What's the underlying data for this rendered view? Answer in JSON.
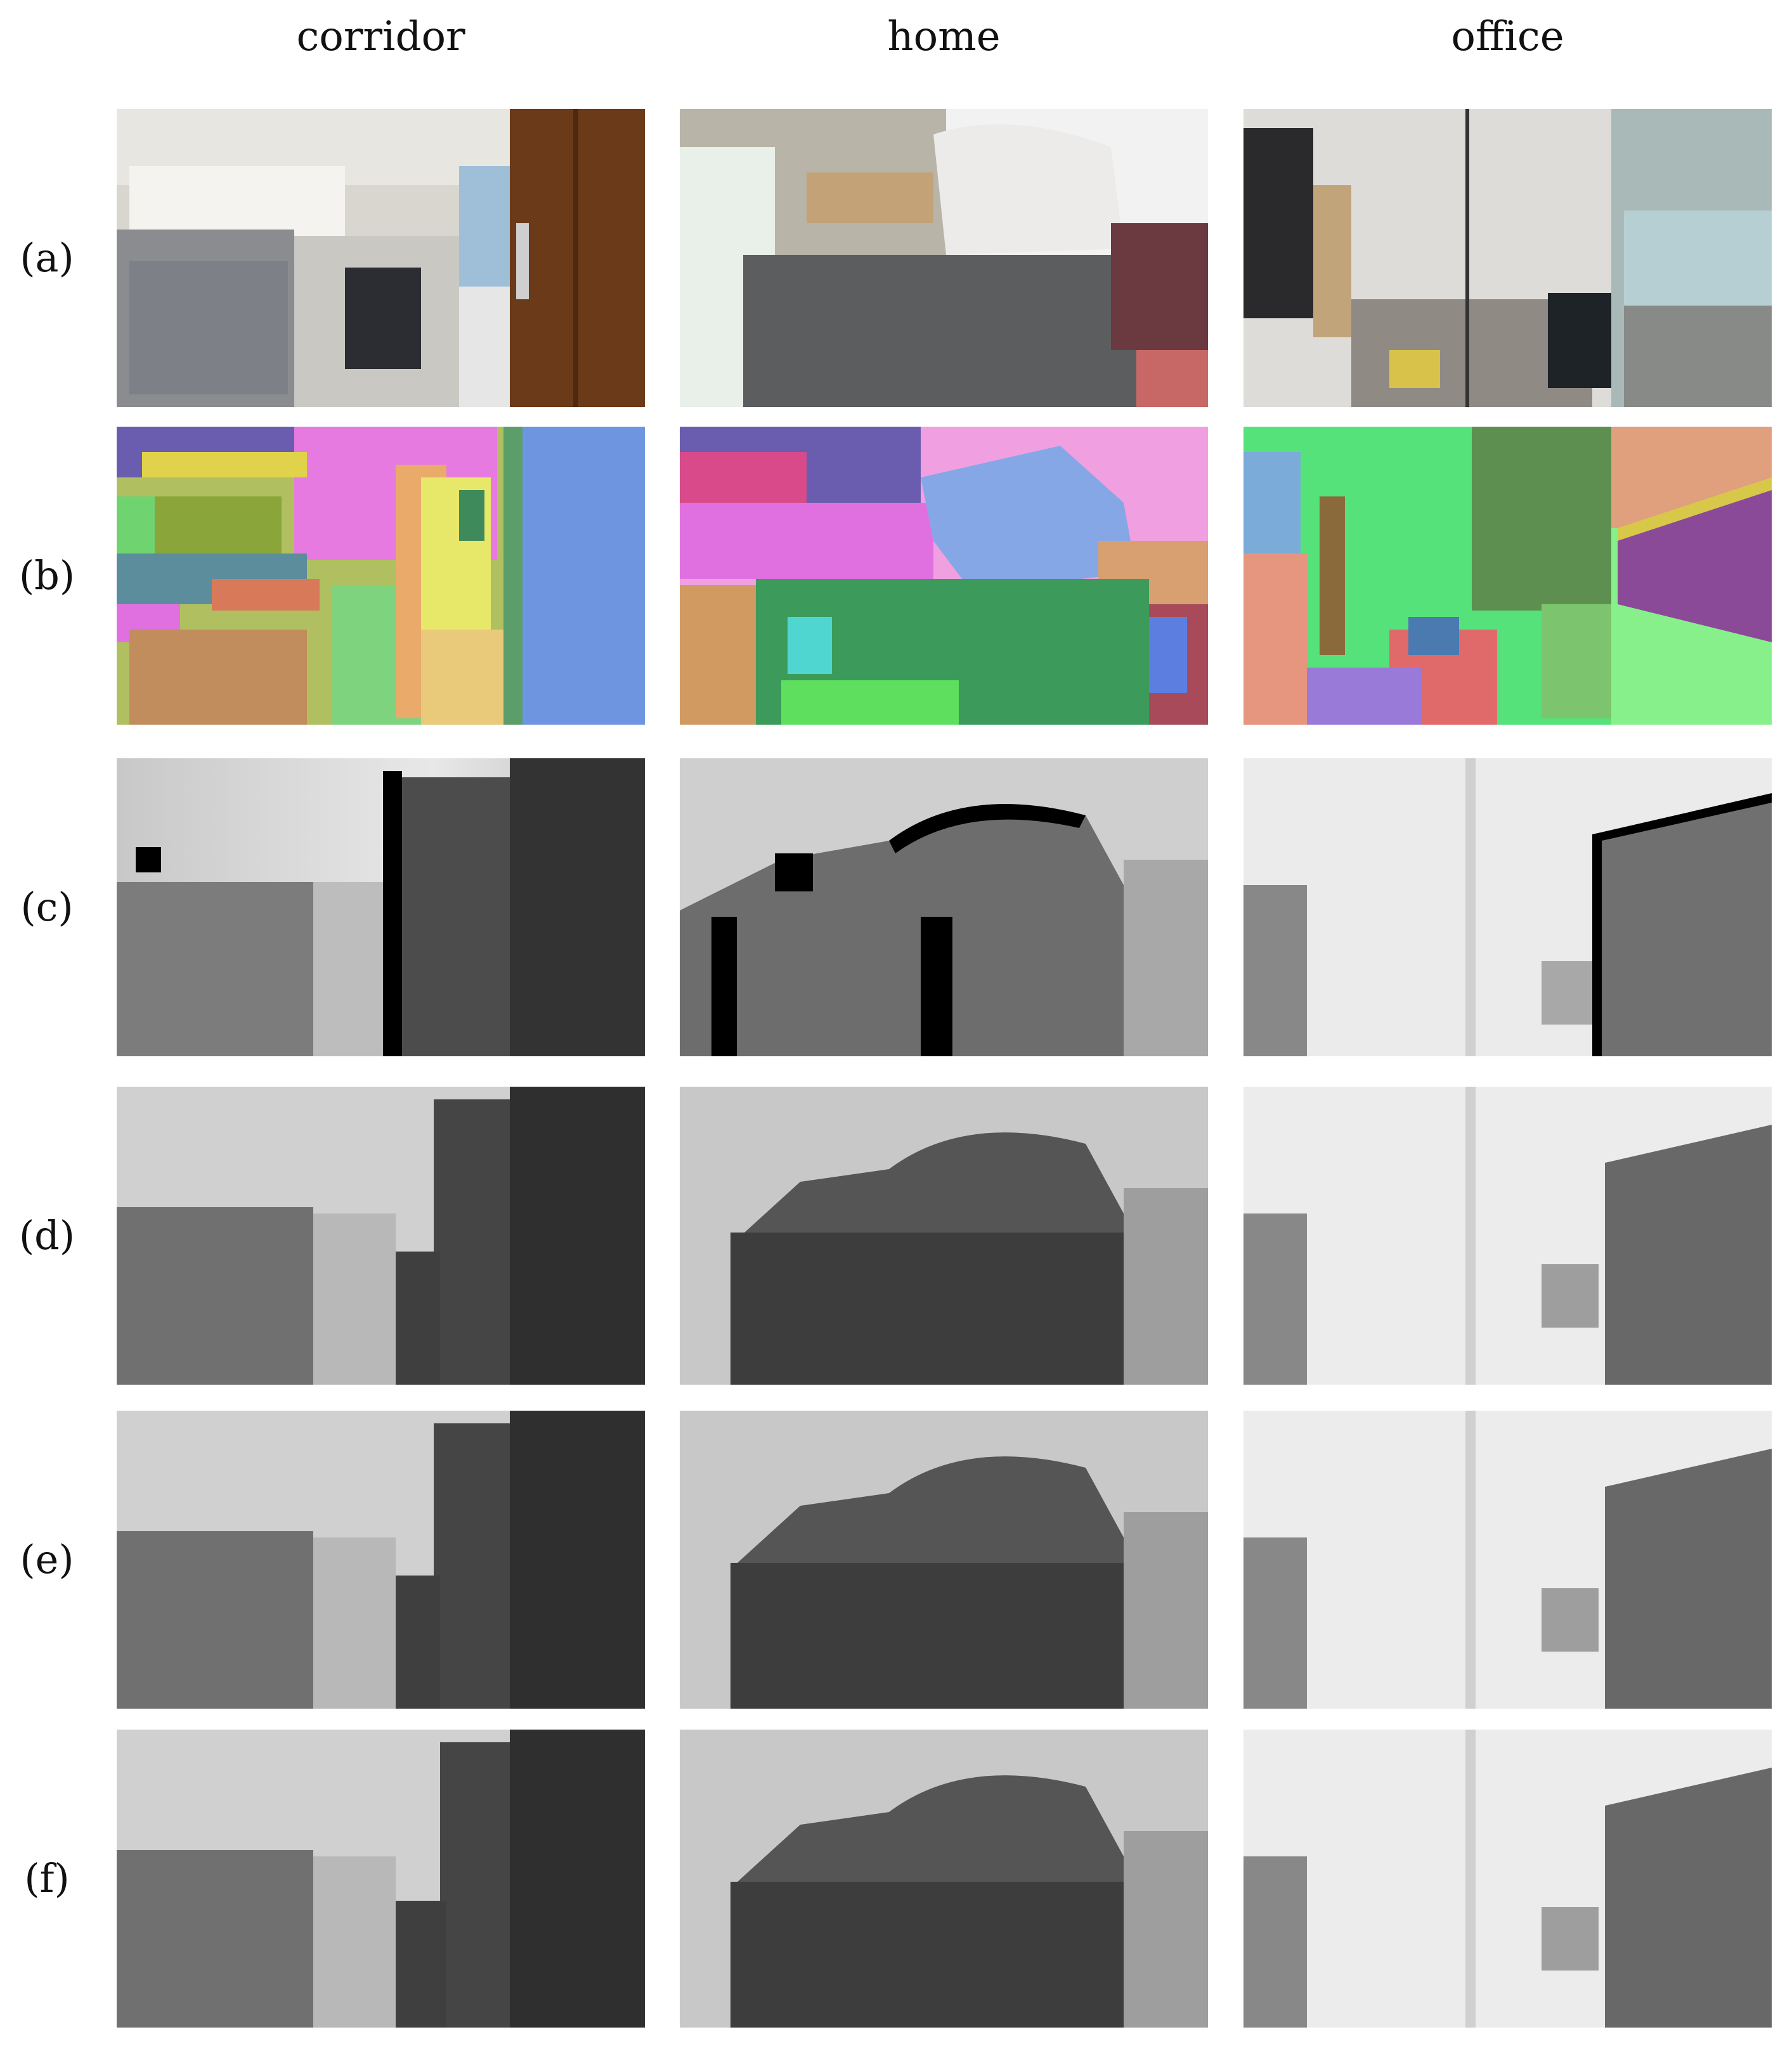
{
  "figure": {
    "columns": [
      {
        "id": "corridor",
        "label": "corridor"
      },
      {
        "id": "home",
        "label": "home"
      },
      {
        "id": "office",
        "label": "office"
      }
    ],
    "rows": [
      {
        "id": "a",
        "label": "(a)",
        "content": "RGB image"
      },
      {
        "id": "b",
        "label": "(b)",
        "content": "color segmentation"
      },
      {
        "id": "c",
        "label": "(c)",
        "content": "raw depth map with holes"
      },
      {
        "id": "d",
        "label": "(d)",
        "content": "filled depth map"
      },
      {
        "id": "e",
        "label": "(e)",
        "content": "filled depth map"
      },
      {
        "id": "f",
        "label": "(f)",
        "content": "filled depth map"
      }
    ]
  }
}
